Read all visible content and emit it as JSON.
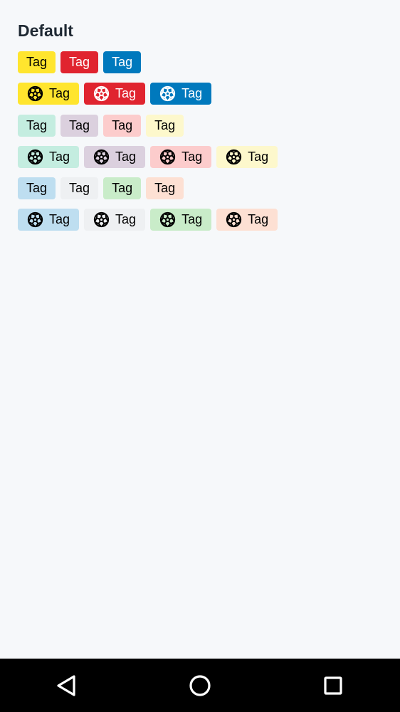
{
  "page": {
    "title": "Default"
  },
  "colors": {
    "yellow": "#ffe52e",
    "red": "#e0242f",
    "blue": "#0079bd",
    "teal_light": "#c4ede0",
    "purple_light": "#dbd0de",
    "pink_light": "#fccccc",
    "yellow_light": "#fdf8cc",
    "blue_light": "#bedef0",
    "gray_light": "#eef0f2",
    "green_light": "#c9ecc9",
    "peach_light": "#fde0d3",
    "text_dark": "#000000",
    "text_light": "#ffffff"
  },
  "rows": [
    {
      "tags": [
        {
          "label": "Tag",
          "bg": "#ffe52e",
          "fg": "#000000",
          "icon": null
        },
        {
          "label": "Tag",
          "bg": "#e0242f",
          "fg": "#ffffff",
          "icon": null
        },
        {
          "label": "Tag",
          "bg": "#0079bd",
          "fg": "#ffffff",
          "icon": null
        }
      ]
    },
    {
      "tags": [
        {
          "label": "Tag",
          "bg": "#ffe52e",
          "fg": "#000000",
          "icon": "soccer-ball-icon"
        },
        {
          "label": "Tag",
          "bg": "#e0242f",
          "fg": "#ffffff",
          "icon": "soccer-ball-icon"
        },
        {
          "label": "Tag",
          "bg": "#0079bd",
          "fg": "#ffffff",
          "icon": "soccer-ball-icon"
        }
      ]
    },
    {
      "tags": [
        {
          "label": "Tag",
          "bg": "#c4ede0",
          "fg": "#000000",
          "icon": null
        },
        {
          "label": "Tag",
          "bg": "#dbd0de",
          "fg": "#000000",
          "icon": null
        },
        {
          "label": "Tag",
          "bg": "#fccccc",
          "fg": "#000000",
          "icon": null
        },
        {
          "label": "Tag",
          "bg": "#fdf8cc",
          "fg": "#000000",
          "icon": null
        }
      ]
    },
    {
      "tags": [
        {
          "label": "Tag",
          "bg": "#c4ede0",
          "fg": "#000000",
          "icon": "soccer-ball-icon"
        },
        {
          "label": "Tag",
          "bg": "#dbd0de",
          "fg": "#000000",
          "icon": "soccer-ball-icon"
        },
        {
          "label": "Tag",
          "bg": "#fccccc",
          "fg": "#000000",
          "icon": "soccer-ball-icon"
        },
        {
          "label": "Tag",
          "bg": "#fdf8cc",
          "fg": "#000000",
          "icon": "soccer-ball-icon"
        }
      ]
    },
    {
      "tags": [
        {
          "label": "Tag",
          "bg": "#bedef0",
          "fg": "#000000",
          "icon": null
        },
        {
          "label": "Tag",
          "bg": "#eef0f2",
          "fg": "#000000",
          "icon": null
        },
        {
          "label": "Tag",
          "bg": "#c9ecc9",
          "fg": "#000000",
          "icon": null
        },
        {
          "label": "Tag",
          "bg": "#fde0d3",
          "fg": "#000000",
          "icon": null
        }
      ]
    },
    {
      "tags": [
        {
          "label": "Tag",
          "bg": "#bedef0",
          "fg": "#000000",
          "icon": "soccer-ball-icon"
        },
        {
          "label": "Tag",
          "bg": "#eef0f2",
          "fg": "#000000",
          "icon": "soccer-ball-icon"
        },
        {
          "label": "Tag",
          "bg": "#c9ecc9",
          "fg": "#000000",
          "icon": "soccer-ball-icon"
        },
        {
          "label": "Tag",
          "bg": "#fde0d3",
          "fg": "#000000",
          "icon": "soccer-ball-icon"
        }
      ]
    }
  ],
  "navbar": {
    "back_icon": "back-triangle-icon",
    "home_icon": "home-circle-icon",
    "recents_icon": "recents-square-icon"
  }
}
